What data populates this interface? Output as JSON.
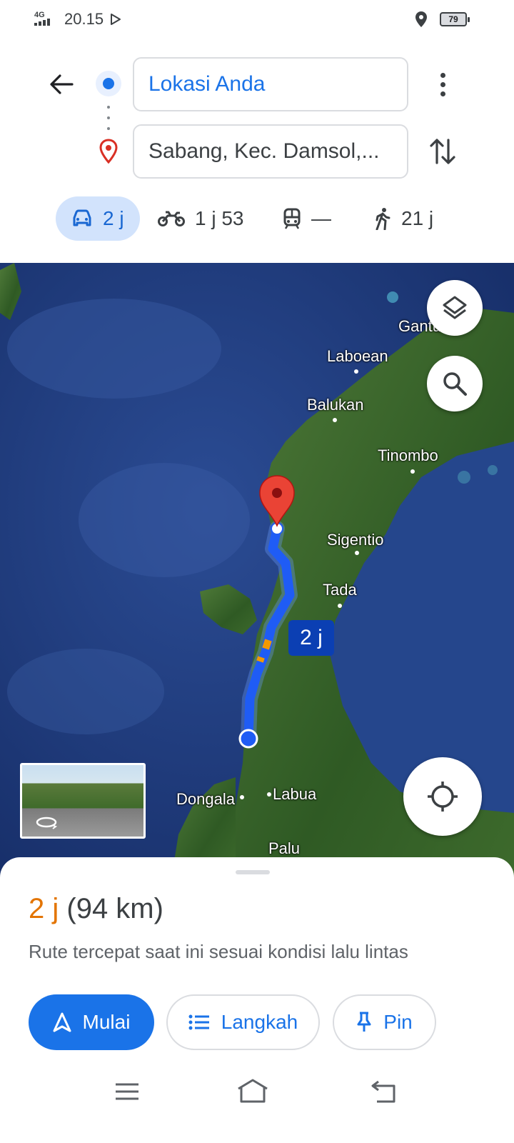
{
  "status_bar": {
    "network": "4G",
    "time": "20.15",
    "battery": "79"
  },
  "header": {
    "origin_value": "Lokasi Anda",
    "destination_value": "Sabang, Kec. Damsol,..."
  },
  "modes": [
    {
      "icon": "car-icon",
      "label": "2 j",
      "selected": true
    },
    {
      "icon": "motorcycle-icon",
      "label": "1 j 53"
    },
    {
      "icon": "train-icon",
      "label": "—"
    },
    {
      "icon": "walk-icon",
      "label": "21 j"
    }
  ],
  "map": {
    "places": [
      "Gantu",
      "Laboean",
      "Balukan",
      "Tinombo",
      "Sigentio",
      "Tada",
      "Dongala",
      "Labua",
      "Palu"
    ],
    "route_label": "2 j",
    "controls": [
      "layers-icon",
      "search-icon",
      "my-location-icon"
    ],
    "street_view_icon": "rotate-360-icon"
  },
  "sheet": {
    "duration": "2 j",
    "distance": "(94 km)",
    "description": "Rute tercepat saat ini sesuai kondisi lalu lintas",
    "start_label": "Mulai",
    "steps_label": "Langkah",
    "pin_label": "Pin"
  },
  "colors": {
    "accent": "#1a73e8",
    "duration": "#e37400",
    "route": "#1f5cf5",
    "destination_pin": "#d93025"
  }
}
